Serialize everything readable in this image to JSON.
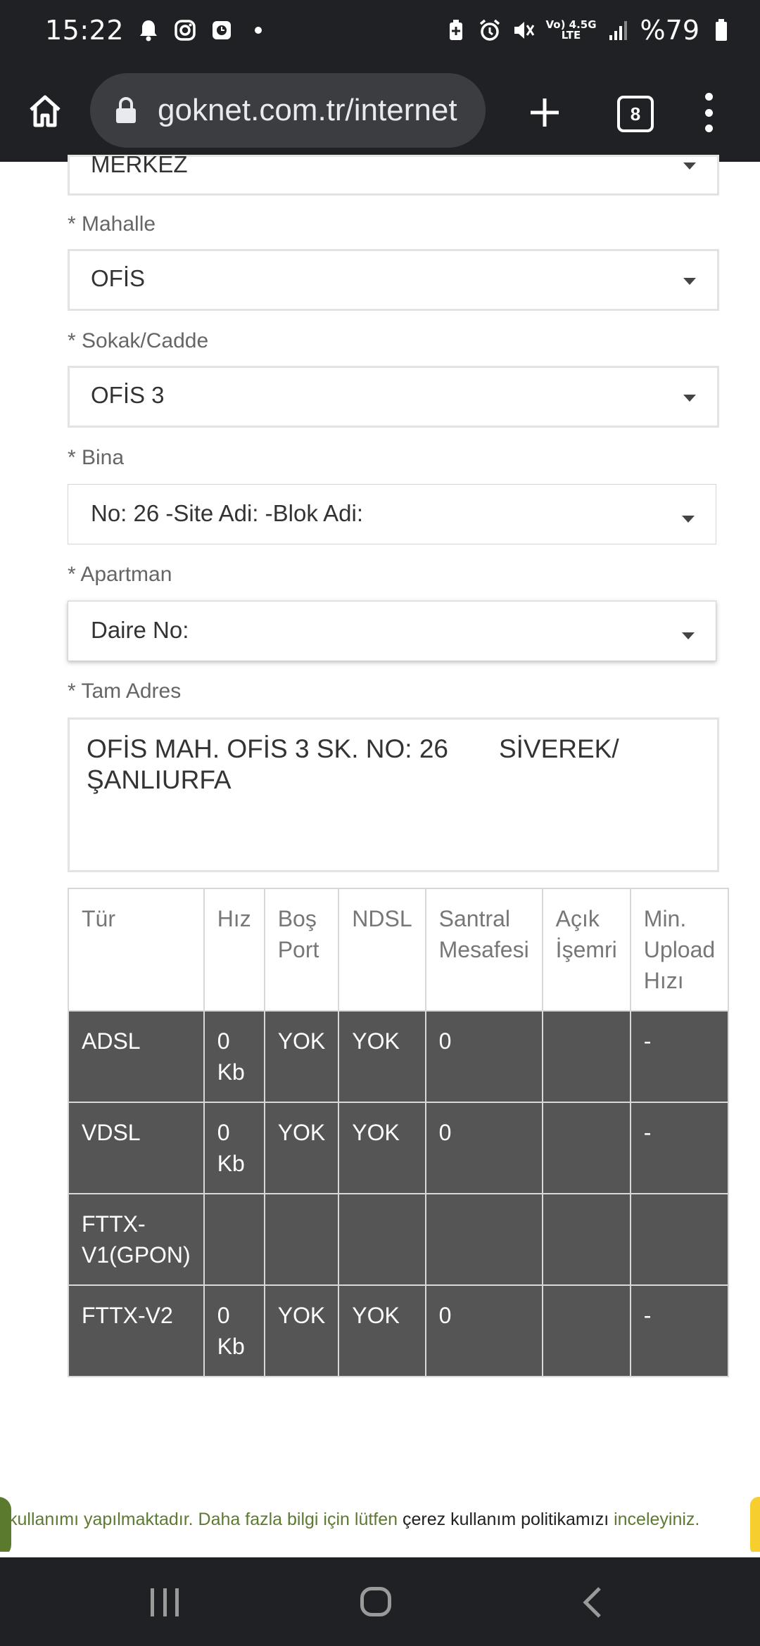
{
  "status_bar": {
    "time": "15:22",
    "network_small_top": "Vo) 4.5G",
    "network_small_bottom": "LTE",
    "battery": "%79",
    "icons": [
      "bell-icon",
      "instagram-icon",
      "app-icon",
      "dot-icon",
      "battery-saver-icon",
      "alarm-icon",
      "mute-icon",
      "signal-icon",
      "battery-icon"
    ]
  },
  "browser": {
    "url": "goknet.com.tr/internet",
    "tab_count": "8"
  },
  "form": {
    "partial_select_value": "MERKEZ",
    "mahalle": {
      "label": "* Mahalle",
      "value": "OFİS"
    },
    "sokak": {
      "label": "* Sokak/Cadde",
      "value": "OFİS 3"
    },
    "bina": {
      "label": "* Bina",
      "value": "No: 26 -Site Adi: -Blok Adi:"
    },
    "apartman": {
      "label": "* Apartman",
      "value": "Daire No:"
    },
    "tam_adres": {
      "label": "* Tam Adres",
      "value": "OFİS MAH. OFİS 3 SK. NO: 26       SİVEREK/ ŞANLIURFA"
    }
  },
  "table": {
    "headers": [
      "Tür",
      "Hız",
      "Boş Port",
      "NDSL",
      "Santral Mesafesi",
      "Açık İşemri",
      "Min. Upload Hızı"
    ],
    "rows": [
      [
        "ADSL",
        "0 Kb",
        "YOK",
        "YOK",
        "0",
        "",
        "-"
      ],
      [
        "VDSL",
        "0 Kb",
        "YOK",
        "YOK",
        "0",
        "",
        "-"
      ],
      [
        "FTTX-V1(GPON)",
        "",
        "",
        "",
        "",
        "",
        ""
      ],
      [
        "FTTX-V2",
        "0 Kb",
        "YOK",
        "YOK",
        "0",
        "",
        "-"
      ]
    ]
  },
  "cookie": {
    "text_start": "kullanımı yapılmaktadır. Daha fazla bilgi için lütfen ",
    "link": "çerez kullanım politikamızı",
    "text_end": " inceleyiniz."
  },
  "colors": {
    "chrome_dark": "#202124",
    "url_bar": "#3c3d40",
    "table_row": "#555555",
    "cookie_green": "#5d7a32",
    "cookie_accent": "#f6cf2f"
  }
}
